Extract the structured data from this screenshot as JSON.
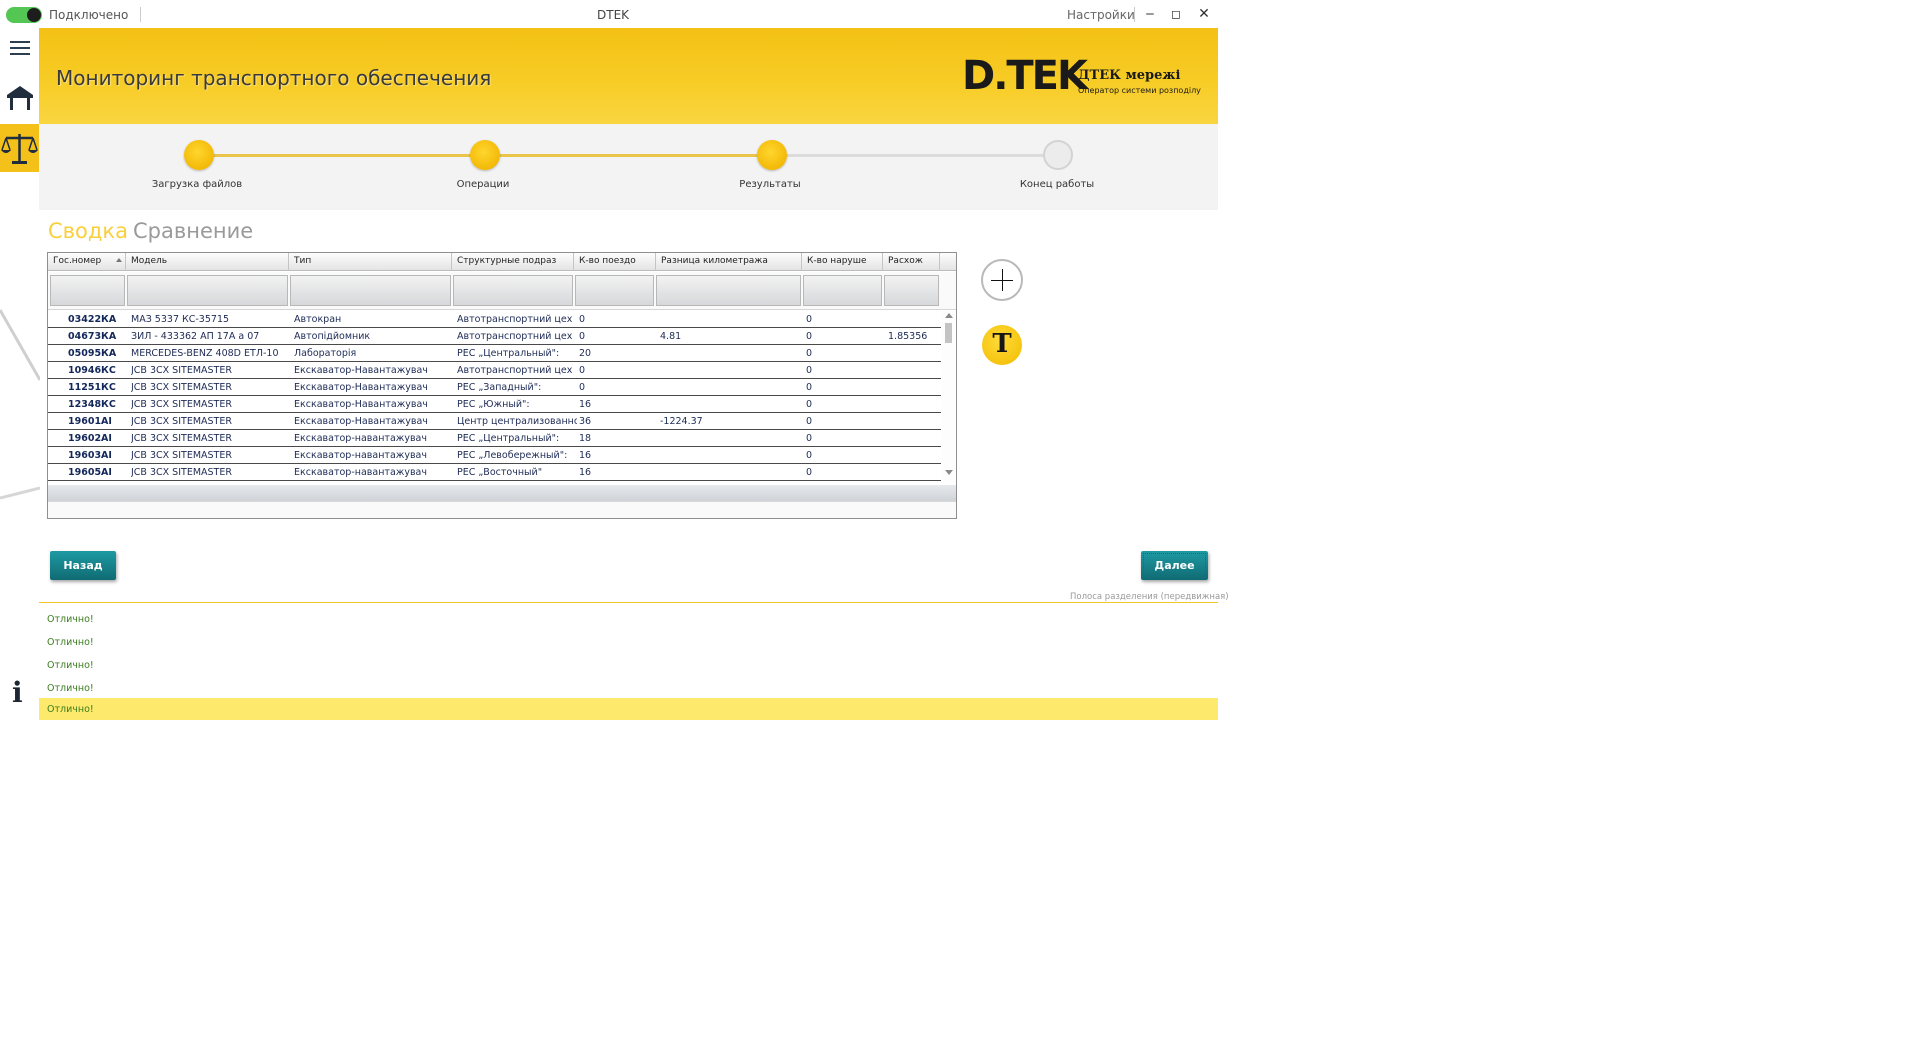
{
  "titlebar": {
    "status": "Подключено",
    "title": "DTEK",
    "settings": "Настройки",
    "minimize": "‒",
    "maximize": "◻",
    "close": "✕"
  },
  "header": {
    "page_title": "Мониторинг транспортного обеспечения",
    "logo_mark": "D.TEK",
    "logo_name": "ДТЕК мережі",
    "logo_subtitle": "Оператор системи розподілу"
  },
  "stepper": {
    "steps": [
      {
        "label": "Загрузка файлов",
        "status": "done"
      },
      {
        "label": "Операции",
        "status": "done"
      },
      {
        "label": "Результаты",
        "status": "done"
      },
      {
        "label": "Конец работы",
        "status": "pending"
      }
    ]
  },
  "tabs": [
    {
      "label": "Сводка",
      "active": true
    },
    {
      "label": "Сравнение",
      "active": false
    }
  ],
  "grid": {
    "columns": [
      "Гос.номер",
      "Модель",
      "Тип",
      "Структурные подраз",
      "К-во поездо",
      "Разница километража",
      "К-во наруше",
      "Расхож"
    ],
    "rows": [
      [
        "03422КА",
        "МАЗ 5337  КС-35715",
        "Автокран",
        "Автотранспортний цех",
        "0",
        "",
        "0",
        ""
      ],
      [
        "04673КА",
        "ЗИЛ - 433362 АП 17А а 07",
        "Автопідйомник",
        "Автотранспортний цех",
        "0",
        "4.81",
        "0",
        "1.85356"
      ],
      [
        "05095КА",
        "MERCEDES-BENZ 408D  ЕТЛ-10",
        "Лабораторія",
        "РЕС „Центральный\":",
        "20",
        "",
        "0",
        ""
      ],
      [
        "10946КС",
        "JCB 3CX SITEMASTER",
        "Екскаватор-Навантажувач",
        "Автотранспортний цех",
        "0",
        "",
        "0",
        ""
      ],
      [
        "11251КС",
        "JCB 3CX SITEMASTER",
        "Екскаватор-Навантажувач",
        "РЕС „Западный\":",
        "0",
        "",
        "0",
        ""
      ],
      [
        "12348КС",
        "JCB 3CX SITEMASTER",
        "Екскаватор-Навантажувач",
        "РЕС „Южный\":",
        "16",
        "",
        "0",
        ""
      ],
      [
        "19601АІ",
        "JCB 3CX SITEMASTER",
        "Екскаватор-Навантажувач",
        "Центр централизованного",
        "36",
        "-1224.37",
        "0",
        ""
      ],
      [
        "19602АІ",
        "JCB 3CX SITEMASTER",
        "Екскаватор-навантажувач",
        "РЕС „Центральный\":",
        "18",
        "",
        "0",
        ""
      ],
      [
        "19603АІ",
        "JCB 3CX SITEMASTER",
        "Екскаватор-навантажувач",
        "РЕС „Левобережный\":",
        "16",
        "",
        "0",
        ""
      ],
      [
        "19605АІ",
        "JCB 3CX SITEMASTER",
        "Екскаватор-навантажувач",
        "РЕС „Восточный\"",
        "16",
        "",
        "0",
        ""
      ]
    ]
  },
  "tools": {
    "text_tool": "T"
  },
  "buttons": {
    "back": "Назад",
    "next": "Далее"
  },
  "splitter_label": "Полоса разделения (передвижная)",
  "log": [
    "Отлично!",
    "Отлично!",
    "Отлично!",
    "Отлично!",
    "Отлично!"
  ],
  "colors": {
    "accent": "#f4c115",
    "button": "#127780",
    "log_text": "#3a7d1e",
    "selected_log": "#fde96c"
  }
}
